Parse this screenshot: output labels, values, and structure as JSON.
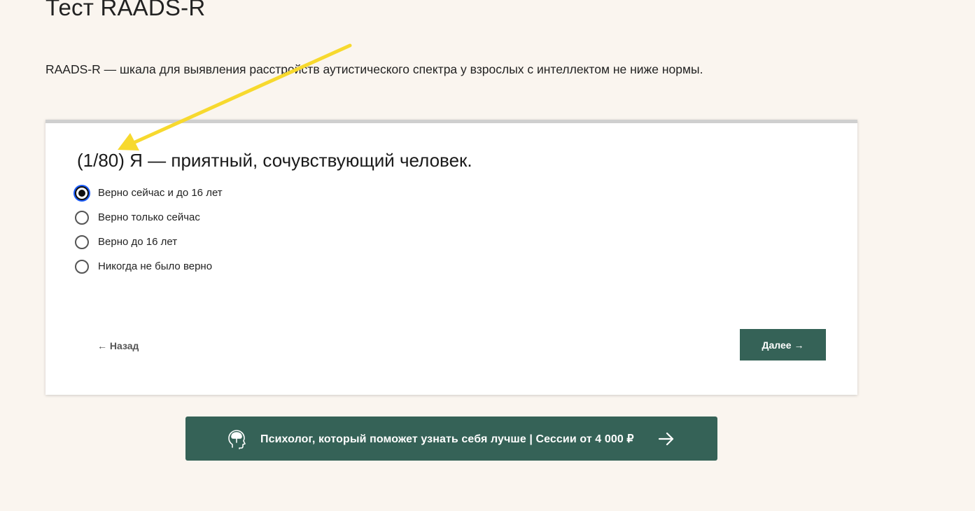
{
  "page": {
    "title": "Тест RAADS-R",
    "intro": "RAADS-R — шкала для выявления расстройств аутистического спектра у взрослых с интеллектом не ниже нормы."
  },
  "quiz": {
    "question": "(1/80) Я — приятный, сочувствующий человек.",
    "options": [
      {
        "label": "Верно сейчас и до 16 лет",
        "selected": true
      },
      {
        "label": "Верно только сейчас",
        "selected": false
      },
      {
        "label": "Верно до 16 лет",
        "selected": false
      },
      {
        "label": "Никогда не было верно",
        "selected": false
      }
    ],
    "back_label": "← Назад",
    "next_label": "Далее →"
  },
  "promo": {
    "text": "Психолог, который поможет узнать себя лучше | Сессии от 4 000 ₽",
    "icon": "head-brain-icon",
    "arrow_icon": "arrow-right-icon"
  },
  "annotation": {
    "color": "#f7d92e",
    "icon": "yellow-arrow"
  },
  "colors": {
    "background": "#faf5ef",
    "accent": "#356257",
    "selected_ring": "#1a5cff"
  }
}
